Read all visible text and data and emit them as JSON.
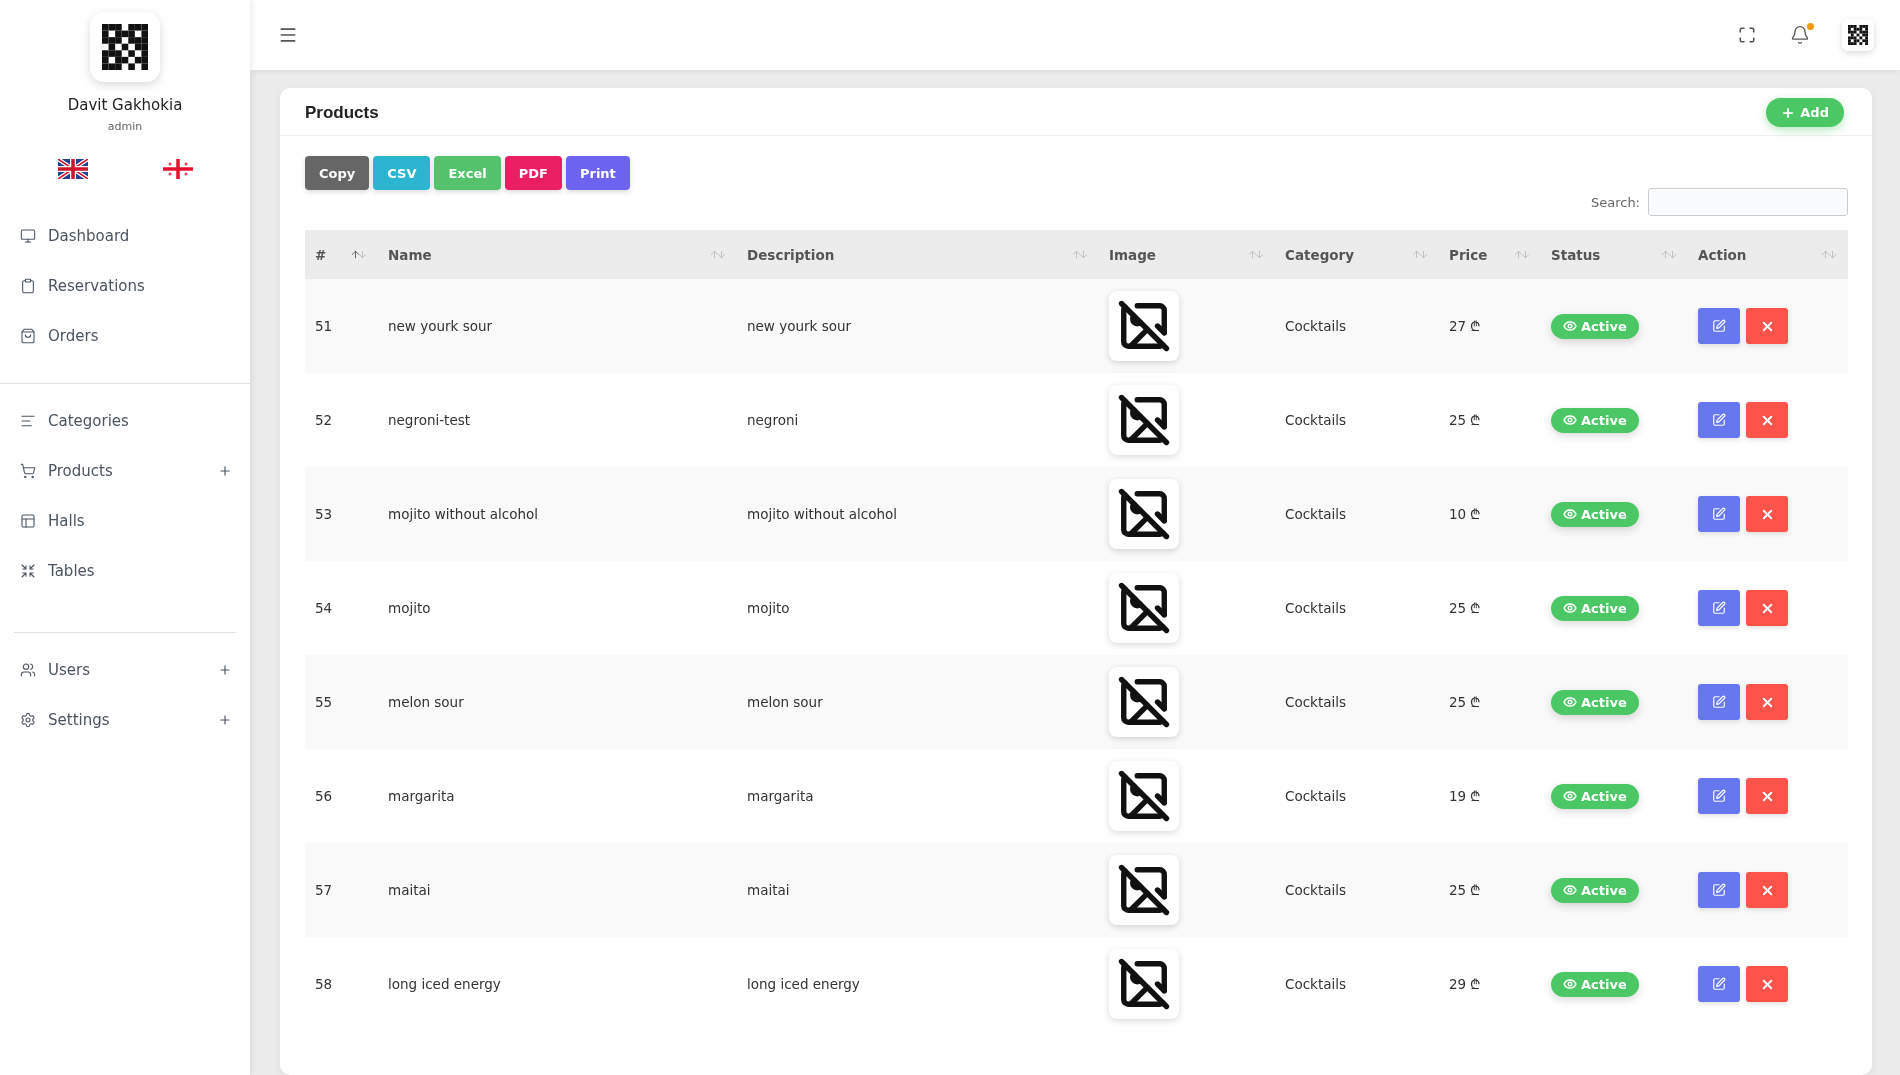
{
  "sidebar": {
    "user": {
      "name": "Davit Gakhokia",
      "role": "admin"
    },
    "groups": [
      [
        {
          "label": "Dashboard",
          "expandable": false
        },
        {
          "label": "Reservations",
          "expandable": false
        },
        {
          "label": "Orders",
          "expandable": false
        }
      ],
      [
        {
          "label": "Categories",
          "expandable": false
        },
        {
          "label": "Products",
          "expandable": true
        },
        {
          "label": "Halls",
          "expandable": false
        },
        {
          "label": "Tables",
          "expandable": false
        }
      ],
      [
        {
          "label": "Users",
          "expandable": true
        },
        {
          "label": "Settings",
          "expandable": true
        }
      ]
    ]
  },
  "topbar": {
    "notification_unread": true
  },
  "card": {
    "title": "Products",
    "add_button": "Add",
    "export_buttons": [
      {
        "label": "Copy",
        "color": "#666666"
      },
      {
        "label": "CSV",
        "color": "#2bb5d0"
      },
      {
        "label": "Excel",
        "color": "#55c26e"
      },
      {
        "label": "PDF",
        "color": "#e91e63"
      },
      {
        "label": "Print",
        "color": "#6c63f0"
      }
    ],
    "search": {
      "label": "Search:"
    },
    "table": {
      "columns": [
        {
          "label": "#",
          "sorted": true
        },
        {
          "label": "Name",
          "sorted": false
        },
        {
          "label": "Description",
          "sorted": false
        },
        {
          "label": "Image",
          "sorted": false
        },
        {
          "label": "Category",
          "sorted": false
        },
        {
          "label": "Price",
          "sorted": false
        },
        {
          "label": "Status",
          "sorted": false
        },
        {
          "label": "Action",
          "sorted": false
        }
      ],
      "rows": [
        {
          "id": "51",
          "name": "new yourk sour",
          "description": "new yourk sour",
          "category": "Cocktails",
          "price": "27 ₾",
          "status": {
            "label": "Active",
            "active": true
          }
        },
        {
          "id": "52",
          "name": "negroni-test",
          "description": "negroni",
          "category": "Cocktails",
          "price": "25 ₾",
          "status": {
            "label": "Active",
            "active": true
          }
        },
        {
          "id": "53",
          "name": "mojito without alcohol",
          "description": "mojito without alcohol",
          "category": "Cocktails",
          "price": "10 ₾",
          "status": {
            "label": "Active",
            "active": true
          }
        },
        {
          "id": "54",
          "name": "mojito",
          "description": "mojito",
          "category": "Cocktails",
          "price": "25 ₾",
          "status": {
            "label": "Active",
            "active": true
          }
        },
        {
          "id": "55",
          "name": "melon sour",
          "description": "melon sour",
          "category": "Cocktails",
          "price": "25 ₾",
          "status": {
            "label": "Active",
            "active": true
          }
        },
        {
          "id": "56",
          "name": "margarita",
          "description": "margarita",
          "category": "Cocktails",
          "price": "19 ₾",
          "status": {
            "label": "Active",
            "active": true
          }
        },
        {
          "id": "57",
          "name": "maitai",
          "description": "maitai",
          "category": "Cocktails",
          "price": "25 ₾",
          "status": {
            "label": "Active",
            "active": true
          }
        },
        {
          "id": "58",
          "name": "long iced energy",
          "description": "long iced energy",
          "category": "Cocktails",
          "price": "29 ₾",
          "status": {
            "label": "Active",
            "active": true
          }
        }
      ]
    }
  }
}
